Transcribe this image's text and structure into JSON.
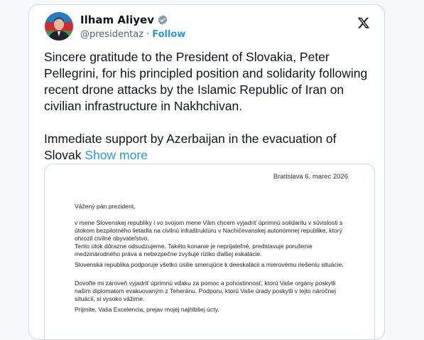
{
  "tweet": {
    "author_name": "Ilham Aliyev",
    "handle": "@presidentaz",
    "separator": "·",
    "follow_label": "Follow",
    "paragraph_1": "Sincere gratitude to the President of Slovakia, Peter Pellegrini, for his principled position and solidarity following recent drone attacks by the Islamic Republic of Iran on civilian infrastructure in Nakhchivan.",
    "paragraph_2": "Immediate support by Azerbaijan in the evacuation of Slovak",
    "show_more_label": "Show more",
    "verified_color": "#829aab",
    "link_color": "#1d9bf0",
    "logo_icon": "x-logo-icon"
  },
  "letter": {
    "date": "Bratislava 6. marec 2026",
    "salutation": "Vážený pán prezident,",
    "p1": "v mene Slovenskej republiky i vo svojom mene Vám chcem vyjadriť úprimnú solidaritu v súvislosti s útokom bezpilotného lietadla na civilnú infraštruktúru v Nachičevanskej autonómnej republike, ktorý ohrozil civilné obyvateľstvo.",
    "p2": "Tento útok dôrazne odsudzujeme. Takéto konanie je neprijateľné, predstavuje porušenie medzinárodného práva a nebezpečne zvyšuje riziko ďalšej eskalácie.",
    "p3": "Slovenská republika podporuje všetko úsilie smerujúce k deeskalácii a mierovému riešeniu situácie.",
    "p4": "Dovoľte mi zároveň vyjadriť úprimnú vďaku za pomoc a pohostinnosť, ktorú Vaše orgány poskytli našim diplomatom evakuovaným z Teheránu. Podporu, ktorú Vaše úrady poskytli v tejto náročnej situácii, si vysoko vážime.",
    "closing": "Prijmite, Vaša Excelencia, prejav mojej najhlbšej úcty."
  }
}
